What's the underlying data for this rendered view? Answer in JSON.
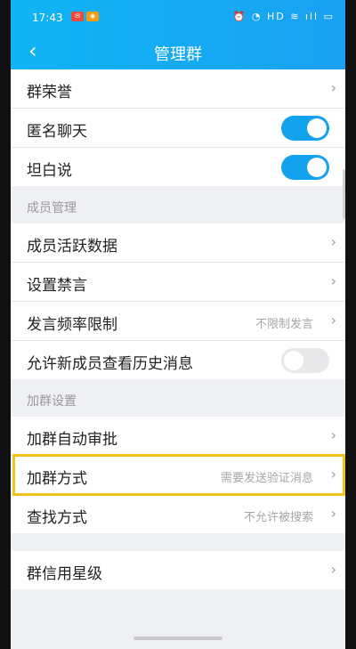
{
  "status": {
    "time": "17:43",
    "icons": "⏰ ◔ HD ≋ ıll ▭"
  },
  "header": {
    "title": "管理群"
  },
  "group1": {
    "items": [
      {
        "label": "群荣誉",
        "value": "",
        "control": "chevron"
      },
      {
        "label": "匿名聊天",
        "value": "",
        "control": "toggle-on"
      },
      {
        "label": "坦白说",
        "value": "",
        "control": "toggle-on"
      }
    ]
  },
  "section_member": "成员管理",
  "group2": {
    "items": [
      {
        "label": "成员活跃数据",
        "value": "",
        "control": "chevron"
      },
      {
        "label": "设置禁言",
        "value": "",
        "control": "chevron"
      },
      {
        "label": "发言频率限制",
        "value": "不限制发言",
        "control": "chevron"
      },
      {
        "label": "允许新成员查看历史消息",
        "value": "",
        "control": "toggle-off"
      }
    ]
  },
  "section_join": "加群设置",
  "group3": {
    "items": [
      {
        "label": "加群自动审批",
        "value": "",
        "control": "chevron"
      },
      {
        "label": "加群方式",
        "value": "需要发送验证消息",
        "control": "chevron",
        "highlighted": true
      },
      {
        "label": "查找方式",
        "value": "不允许被搜索",
        "control": "chevron"
      }
    ]
  },
  "group4": {
    "items": [
      {
        "label": "群信用星级",
        "value": "",
        "control": "chevron"
      }
    ]
  },
  "icons": {
    "back": "chevron-left-icon",
    "chevron": "chevron-right-icon"
  },
  "colors": {
    "accent": "#13a2ec",
    "highlight": "#f4c21a"
  }
}
